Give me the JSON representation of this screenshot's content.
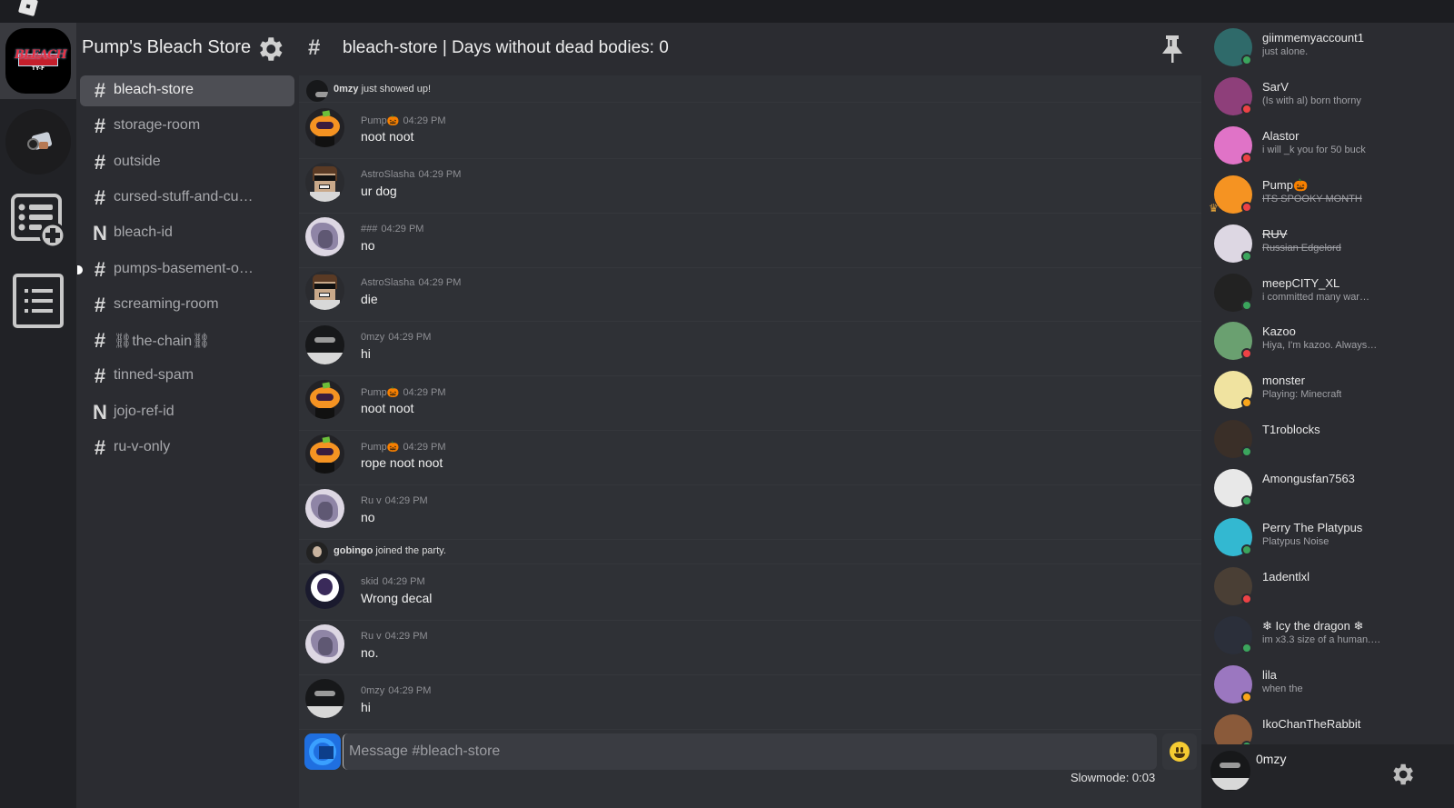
{
  "app": {
    "title": "Roblox"
  },
  "server": {
    "name": "Pump's Bleach Store",
    "icon_text": "BLEACH",
    "icon_sub": "TY-F"
  },
  "channels": [
    {
      "icon": "#",
      "name": "bleach-store",
      "active": true
    },
    {
      "icon": "#",
      "name": "storage-room"
    },
    {
      "icon": "#",
      "name": "outside"
    },
    {
      "icon": "#",
      "name": "cursed-stuff-and-cu…"
    },
    {
      "icon": "N",
      "name": "bleach-id"
    },
    {
      "icon": "#",
      "name": "pumps-basement-o…",
      "unread": true
    },
    {
      "icon": "#",
      "name": "screaming-room"
    },
    {
      "icon": "#",
      "name": "⛓the-chain⛓"
    },
    {
      "icon": "#",
      "name": "tinned-spam"
    },
    {
      "icon": "N",
      "name": "jojo-ref-id"
    },
    {
      "icon": "#",
      "name": "ru-v-only"
    }
  ],
  "header": {
    "hash": "#",
    "title": "bleach-store | Days without dead bodies: 0"
  },
  "messages": [
    {
      "type": "system",
      "user": "0mzy",
      "text": " just showed up!"
    },
    {
      "type": "msg",
      "user": "Pump🎃",
      "time": "04:29 PM",
      "text": "noot noot"
    },
    {
      "type": "msg",
      "user": "AstroSlasha",
      "time": "04:29 PM",
      "text": "ur dog"
    },
    {
      "type": "msg",
      "user": "###",
      "time": "04:29 PM",
      "text": "no"
    },
    {
      "type": "msg",
      "user": "AstroSlasha",
      "time": "04:29 PM",
      "text": "die"
    },
    {
      "type": "msg",
      "user": "0mzy",
      "time": "04:29 PM",
      "text": "hi"
    },
    {
      "type": "msg",
      "user": "Pump🎃",
      "time": "04:29 PM",
      "text": "noot noot"
    },
    {
      "type": "msg",
      "user": "Pump🎃",
      "time": "04:29 PM",
      "text": "rope noot noot"
    },
    {
      "type": "msg",
      "user": "Ru v",
      "time": "04:29 PM",
      "text": "no"
    },
    {
      "type": "system",
      "user": "gobingo",
      "text": " joined the party."
    },
    {
      "type": "msg",
      "user": "skid",
      "time": "04:29 PM",
      "text": "Wrong decal"
    },
    {
      "type": "msg",
      "user": "Ru v",
      "time": "04:29 PM",
      "text": "no."
    },
    {
      "type": "msg",
      "user": "0mzy",
      "time": "04:29 PM",
      "text": "hi"
    }
  ],
  "composer": {
    "placeholder": "Message #bleach-store",
    "value": "",
    "slowmode": "Slowmode: 0:03"
  },
  "members": [
    {
      "name": "giimmemyaccount1",
      "status": "just alone.",
      "presence": "online"
    },
    {
      "name": "SarV",
      "status": "(Is with al) born thorny",
      "presence": "dnd"
    },
    {
      "name": "Alastor",
      "status": "i will _k you for 50 buck",
      "presence": "dnd"
    },
    {
      "name": "Pump🎃",
      "status": "ITS SPOOKY MONTH",
      "presence": "dnd",
      "owner": true
    },
    {
      "name": "RUV",
      "status": "Russian Edgelord",
      "presence": "online"
    },
    {
      "name": "meepCITY_XL",
      "status": "i committed many war…",
      "presence": "online"
    },
    {
      "name": "Kazoo",
      "status": "Hiya, I'm kazoo. Always…",
      "presence": "dnd"
    },
    {
      "name": "monster",
      "status": "Playing: Minecraft",
      "presence": "idle"
    },
    {
      "name": "T1roblocks",
      "status": "",
      "presence": "online"
    },
    {
      "name": "Amongusfan7563",
      "status": "",
      "presence": "online"
    },
    {
      "name": "Perry The Platypus",
      "status": "Platypus Noise",
      "presence": "online"
    },
    {
      "name": "1adentlxl",
      "status": "",
      "presence": "dnd"
    },
    {
      "name": "❄ Icy the dragon ❄",
      "status": "im x3.3 size of a human.…",
      "presence": "online"
    },
    {
      "name": "lila",
      "status": "when the",
      "presence": "idle"
    },
    {
      "name": "IkoChanTheRabbit",
      "status": "",
      "presence": "online"
    }
  ],
  "current_user": {
    "name": "0mzy"
  },
  "colors": {
    "online": "#3ba55d",
    "dnd": "#ed4245",
    "idle": "#faa61a",
    "accent": "#4d4e54"
  }
}
